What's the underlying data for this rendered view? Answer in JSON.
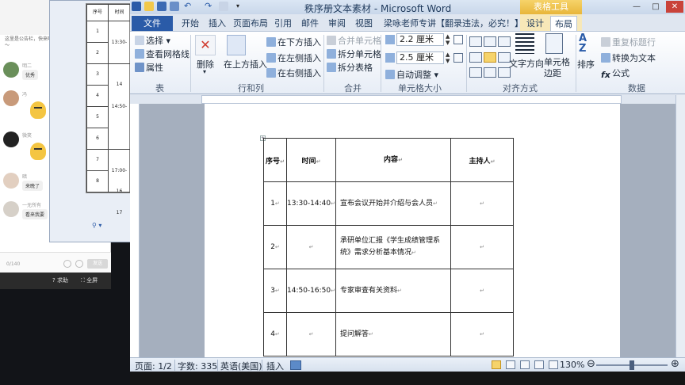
{
  "window": {
    "title": "秩序册文本素材 - Microsoft Word",
    "contextual_tool": "表格工具",
    "controls": [
      "—",
      "□",
      "✕"
    ]
  },
  "tabs": [
    "文件",
    "开始",
    "插入",
    "页面布局",
    "引用",
    "邮件",
    "审阅",
    "视图",
    "梁咏老师专讲【翻录违法，必究！】",
    "设计",
    "布局"
  ],
  "active_tab": "布局",
  "ribbon": {
    "groups": {
      "table": {
        "label": "表",
        "select": "选择",
        "gridlines": "查看网格线",
        "properties": "属性"
      },
      "delete": {
        "label": "删除"
      },
      "rows_cols": {
        "label": "行和列",
        "insert_above": "在上方插入",
        "insert_below": "在下方插入",
        "insert_left": "在左侧插入",
        "insert_right": "在右侧插入"
      },
      "merge": {
        "label": "合并",
        "merge_cells": "合并单元格",
        "split_cells": "拆分单元格",
        "split_table": "拆分表格"
      },
      "cell_size": {
        "label": "单元格大小",
        "height": "2.2 厘米",
        "width": "2.5 厘米",
        "autofit": "自动调整"
      },
      "alignment": {
        "label": "对齐方式",
        "text_direction": "文字方向",
        "cell_margins": "单元格边距"
      },
      "data": {
        "label": "数据",
        "sort": "排序",
        "repeat_header": "重复标题行",
        "convert_text": "转换为文本",
        "formula": "公式"
      }
    }
  },
  "document": {
    "headers": [
      "序号",
      "时间",
      "内容",
      "主持人"
    ],
    "rows": [
      {
        "no": "1",
        "time": "13:30-14:40",
        "content": "宣布会议开始并介绍与会人员",
        "host": ""
      },
      {
        "no": "2",
        "time": "",
        "content": "承研单位汇报《学生成绩管理系统》需求分析基本情况",
        "host": ""
      },
      {
        "no": "3",
        "time": "14:50-16:50",
        "content": "专家审查有关资料",
        "host": ""
      },
      {
        "no": "4",
        "time": "",
        "content": "提问解答",
        "host": ""
      }
    ]
  },
  "status": {
    "page": "页面: 1/2",
    "words": "字数: 335",
    "language": "英语(美国)",
    "mode": "插入",
    "zoom": "130%",
    "zoom_level": 130
  },
  "background": {
    "chat_notice": "这里是公告栏，快来吧～",
    "chat": [
      {
        "name": "明二",
        "text": "优秀"
      },
      {
        "name": "冯",
        "text": ""
      },
      {
        "name": "微笑",
        "text": ""
      },
      {
        "name": "晓",
        "text": ""
      },
      {
        "name": "暗",
        "text": "来晚了"
      },
      {
        "name": "一无所有",
        "text": "看来我要"
      }
    ],
    "char_count": "0/140",
    "send": "发送",
    "help": "求助",
    "fullscreen": "全屏",
    "table_headers": [
      "序号",
      "时间"
    ],
    "table_rows": [
      "1",
      "2",
      "3",
      "4",
      "5",
      "6",
      "7",
      "8"
    ],
    "table_times": [
      "13:30-14",
      "14:50-16",
      "17:00-17"
    ]
  },
  "colors": {
    "file_tab": "#2a5ba8",
    "contextual": "#e8b63a",
    "ribbon_text": "#1e2a3a"
  }
}
